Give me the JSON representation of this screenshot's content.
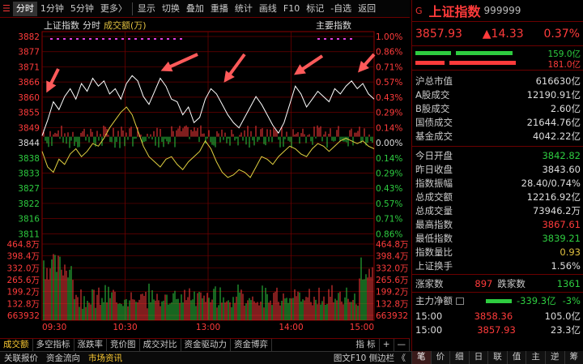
{
  "toolbar": {
    "items": [
      "分时",
      "1分钟",
      "5分钟",
      "更多〉",
      "显示",
      "切换",
      "叠加",
      "重播",
      "统计",
      "画线",
      "F10",
      "标记",
      "-自选",
      "返回"
    ]
  },
  "chart_header": {
    "index": "上证指数",
    "mode": "分时",
    "volume": "成交额(万)",
    "main_index": "主要指数"
  },
  "price_labels": [
    "3882",
    "3877",
    "3871",
    "3866",
    "3860",
    "3855",
    "3849",
    "3844",
    "3838",
    "3833",
    "3827",
    "3822",
    "3816",
    "3811"
  ],
  "pct_labels": [
    "1.00%",
    "0.86%",
    "0.71%",
    "0.57%",
    "0.43%",
    "0.29%",
    "0.14%",
    "0.00%",
    "0.14%",
    "0.29%",
    "0.43%",
    "0.57%",
    "0.71%",
    "0.86%"
  ],
  "vol_labels": [
    "464.8万",
    "398.4万",
    "332.0万",
    "265.6万",
    "199.2万",
    "132.8万",
    "663932"
  ],
  "time_labels": [
    "09:30",
    "10:30",
    "13:00",
    "14:00",
    "15:00"
  ],
  "chart_data": {
    "type": "line",
    "prev_close": 3843.6,
    "ylim": [
      3805,
      3882
    ],
    "series": [
      {
        "name": "white",
        "values": [
          3844,
          3850,
          3857,
          3854,
          3859,
          3862,
          3858,
          3864,
          3861,
          3866,
          3863,
          3865,
          3860,
          3862,
          3858,
          3864,
          3867,
          3865,
          3859,
          3856,
          3861,
          3866,
          3863,
          3858,
          3857,
          3852,
          3855,
          3849,
          3851,
          3858,
          3862,
          3860,
          3856,
          3852,
          3849,
          3847,
          3851,
          3855,
          3859,
          3856,
          3852,
          3848,
          3845,
          3849,
          3856,
          3863,
          3860,
          3855,
          3858,
          3861,
          3859,
          3857,
          3862,
          3860,
          3863,
          3865,
          3862,
          3864,
          3860,
          3858
        ]
      },
      {
        "name": "yellow",
        "values": [
          3838,
          3832,
          3830,
          3835,
          3833,
          3837,
          3839,
          3836,
          3838,
          3841,
          3840,
          3843,
          3847,
          3850,
          3853,
          3855,
          3852,
          3846,
          3840,
          3836,
          3834,
          3832,
          3835,
          3836,
          3833,
          3831,
          3834,
          3836,
          3838,
          3842,
          3839,
          3834,
          3830,
          3828,
          3829,
          3831,
          3830,
          3828,
          3832,
          3836,
          3835,
          3833,
          3836,
          3838,
          3840,
          3839,
          3837,
          3836,
          3839,
          3841,
          3840,
          3838,
          3840,
          3842,
          3843,
          3842,
          3841,
          3842,
          3840,
          3839
        ]
      }
    ],
    "up_color": "#ff3b3b",
    "down_color": "#2ecc40"
  },
  "bottom_tabs": [
    "成交额",
    "多空指标",
    "涨跌率",
    "竞价图",
    "成交对比",
    "资金驱动力",
    "资金博弈",
    "指 标",
    "+",
    "—"
  ],
  "status_bar": {
    "items": [
      "关联报价",
      "资金流向",
      "市场资讯"
    ],
    "right": "图文F10 侧边栏 《"
  },
  "right_buttons": [
    "笔",
    "价",
    "细",
    "日",
    "联",
    "值",
    "主",
    "逆",
    "筹"
  ],
  "quote": {
    "g": "G",
    "name": "上证指数",
    "code": "999999",
    "price": "3857.93",
    "change": "▲14.33",
    "pct": "0.37%",
    "bar1": "159.0亿",
    "bar2": "181.0亿"
  },
  "stats": [
    {
      "l": "沪总市值",
      "v": "616630亿",
      "c": "wht"
    },
    {
      "l": "A股成交",
      "v": "12190.91亿",
      "c": "wht"
    },
    {
      "l": "B股成交",
      "v": "2.60亿",
      "c": "wht"
    },
    {
      "l": "国债成交",
      "v": "21644.76亿",
      "c": "wht"
    },
    {
      "l": "基金成交",
      "v": "4042.22亿",
      "c": "wht"
    }
  ],
  "stats2": [
    {
      "l": "今日开盘",
      "v": "3842.82",
      "c": "grn"
    },
    {
      "l": "昨日收盘",
      "v": "3843.60",
      "c": "wht"
    },
    {
      "l": "指数振幅",
      "v": "28.40/0.74%",
      "c": "wht"
    },
    {
      "l": "总成交额",
      "v": "12216.92亿",
      "c": "wht"
    },
    {
      "l": "总成交量",
      "v": "73946.2万",
      "c": "wht"
    },
    {
      "l": "最高指数",
      "v": "3867.61",
      "c": "red"
    },
    {
      "l": "最低指数",
      "v": "3839.21",
      "c": "grn"
    },
    {
      "l": "指数量比",
      "v": "0.93",
      "c": "yel"
    },
    {
      "l": "上证换手",
      "v": "1.56%",
      "c": "wht"
    }
  ],
  "breadth": {
    "up_label": "涨家数",
    "up": "897",
    "down_label": "跌家数",
    "down": "1361"
  },
  "netflow": {
    "label": "主力净额",
    "value": "-339.3亿",
    "pct": "-3%"
  },
  "ticks": [
    {
      "t": "15:00",
      "p": "3858.36",
      "v": "105.0亿"
    },
    {
      "t": "15:00",
      "p": "3857.93",
      "v": "23.3亿"
    }
  ]
}
